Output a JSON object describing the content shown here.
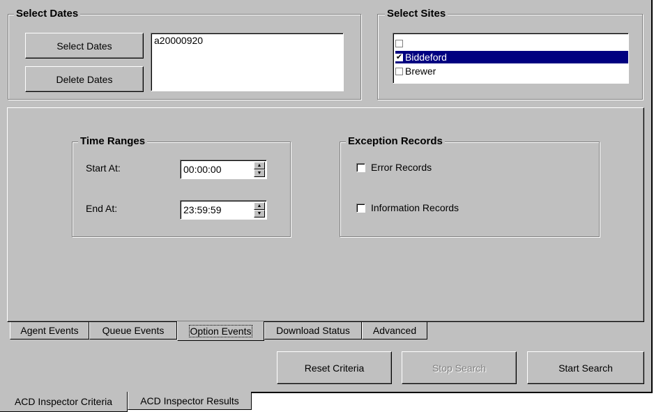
{
  "select_dates": {
    "title": "Select Dates",
    "select_button": "Select Dates",
    "delete_button": "Delete Dates",
    "dates": [
      "a20000920"
    ]
  },
  "select_sites": {
    "title": "Select Sites",
    "items": [
      {
        "label": "",
        "checked": false,
        "selected": false
      },
      {
        "label": "Biddeford",
        "checked": true,
        "selected": true
      },
      {
        "label": "Brewer",
        "checked": false,
        "selected": false
      }
    ]
  },
  "time_ranges": {
    "title": "Time Ranges",
    "start_label": "Start At:",
    "start_value": "00:00:00",
    "end_label": "End At:",
    "end_value": "23:59:59"
  },
  "exception_records": {
    "title": "Exception Records",
    "error_label": "Error Records",
    "error_checked": false,
    "info_label": "Information Records",
    "info_checked": false
  },
  "inner_tabs": [
    "Agent Events",
    "Queue Events",
    "Option Events",
    "Download Status",
    "Advanced"
  ],
  "active_inner_tab": 2,
  "actions": {
    "reset": "Reset Criteria",
    "stop": "Stop Search",
    "start": "Start Search"
  },
  "bottom_tabs": [
    "ACD Inspector Criteria",
    "ACD Inspector Results"
  ],
  "active_bottom_tab": 0
}
